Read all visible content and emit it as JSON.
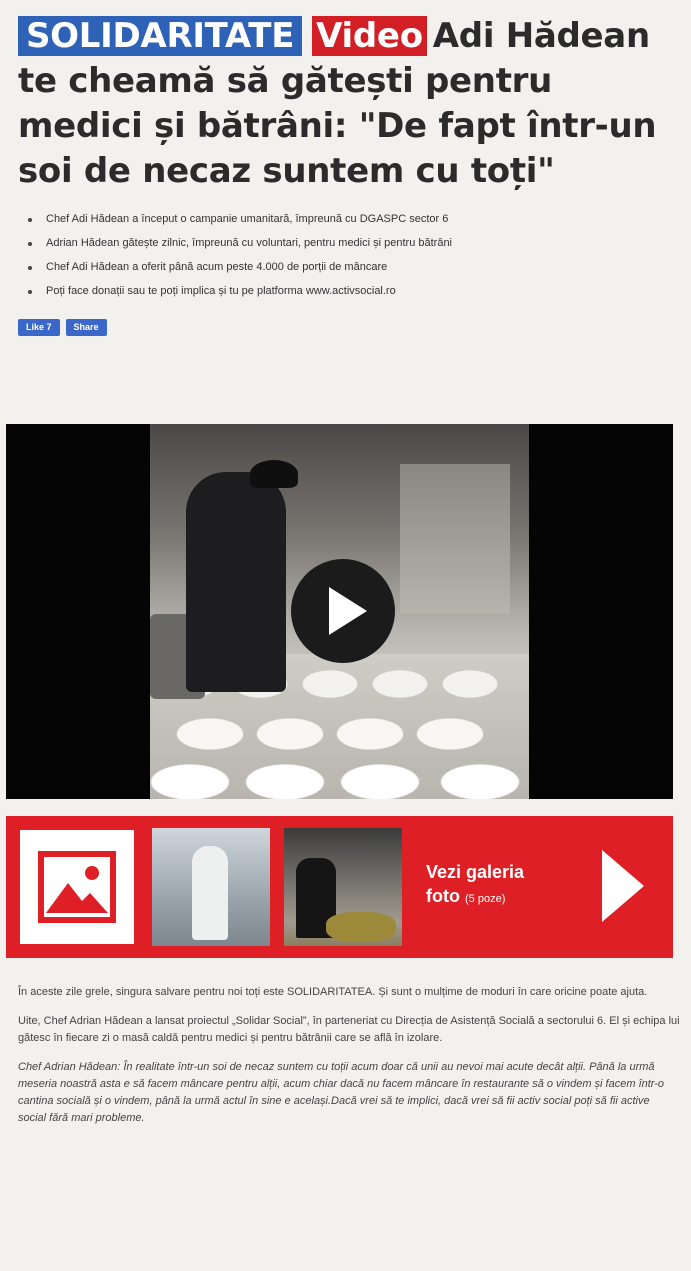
{
  "headline": {
    "tag_category": "SOLIDARITATE",
    "tag_media": "Video",
    "title": "Adi Hădean te cheamă să gătești pentru medici și bătrâni: \"De fapt într-un soi de necaz suntem cu toți\""
  },
  "bullets": [
    "Chef Adi Hădean a început o campanie umanitară, împreună cu DGASPC sector 6",
    "Adrian Hădean gătește zilnic, împreună cu voluntari, pentru medici și pentru bătrâni",
    "Chef Adi Hădean a oferit până acum peste 4.000 de porții de mâncare",
    "Poți face donații sau te poți implica și tu pe platforma www.activsocial.ro"
  ],
  "social": {
    "like_label": "Like 7",
    "share_label": "Share"
  },
  "video": {
    "play_icon": "play-icon"
  },
  "gallery": {
    "cta_line1": "Vezi galeria",
    "cta_line2": "foto",
    "count": "(5 poze)",
    "icon": "image-icon"
  },
  "body": {
    "p1": "În aceste zile grele, singura salvare pentru noi toți este SOLIDARITATEA. Și sunt o mulțime de moduri în care oricine poate ajuta.",
    "p2": "Uite, Chef Adrian Hădean a lansat proiectul „Solidar Social”, în parteneriat cu Direcția de Asistență Socială a sectorului 6. El și echipa lui gătesc în fiecare zi o masă caldă pentru medici și pentru bătrânii care se află în izolare.",
    "p3": "Chef Adrian Hădean: În realitate într-un soi de necaz suntem cu toții acum doar că unii au nevoi mai acute decât alții. Până la urmă meseria noastră asta e să facem mâncare pentru alții, acum chiar dacă nu facem mâncare în restaurante să o vindem și facem într-o cantina socială și o vindem, până la urmă actul în sine e același.Dacă vrei să te implici, dacă vrei să fii activ social poți să fii active social fără mari probleme."
  },
  "colors": {
    "tag_blue": "#2e62b7",
    "tag_red": "#d21f26",
    "gallery_red": "#df1f26",
    "facebook_blue": "#3b67c8"
  }
}
